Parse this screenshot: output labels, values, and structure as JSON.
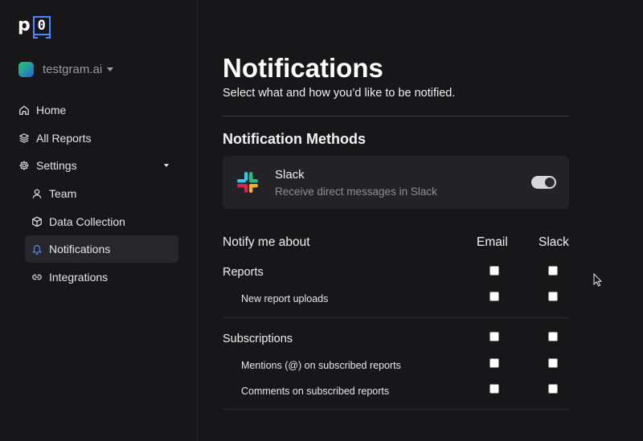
{
  "brand": {
    "logo_letter": "p",
    "logo_digit": "0"
  },
  "workspace": {
    "name": "testgram.ai"
  },
  "sidebar": {
    "items": [
      {
        "label": "Home",
        "icon": "home-icon"
      },
      {
        "label": "All Reports",
        "icon": "layers-icon"
      },
      {
        "label": "Settings",
        "icon": "gear-icon"
      },
      {
        "label": "Team",
        "icon": "user-icon"
      },
      {
        "label": "Data Collection",
        "icon": "cube-icon"
      },
      {
        "label": "Notifications",
        "icon": "bell-icon",
        "active": true
      },
      {
        "label": "Integrations",
        "icon": "link-icon"
      }
    ]
  },
  "main": {
    "title": "Notifications",
    "subtitle": "Select what and how you’d like to be notified.",
    "methods_title": "Notification Methods",
    "method": {
      "name": "Slack",
      "description": "Receive direct messages in Slack",
      "enabled": true
    },
    "table": {
      "header": {
        "topic": "Notify me about",
        "email": "Email",
        "slack": "Slack"
      },
      "groups": [
        {
          "label": "Reports",
          "items": [
            "New report uploads"
          ]
        },
        {
          "label": "Subscriptions",
          "items": [
            "Mentions (@) on subscribed reports",
            "Comments on subscribed reports"
          ]
        }
      ]
    }
  },
  "colors": {
    "accent": "#4a8cff",
    "background": "#17171a",
    "card": "#232327"
  }
}
